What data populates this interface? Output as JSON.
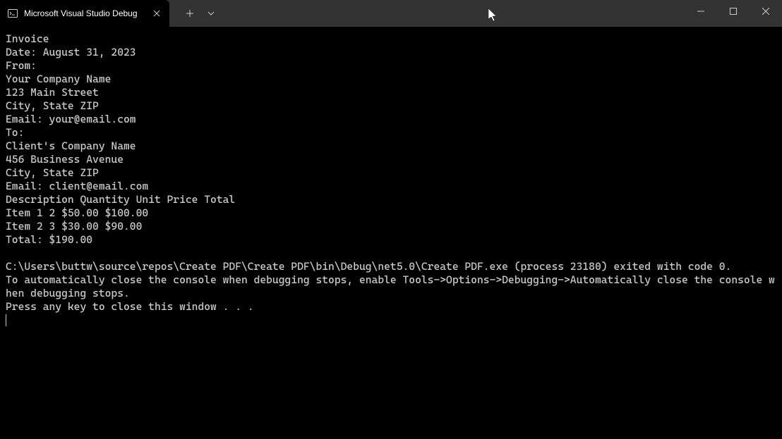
{
  "tab": {
    "title": "Microsoft Visual Studio Debug"
  },
  "output": {
    "lines": [
      "Invoice",
      "Date: August 31, 2023",
      "From:",
      "Your Company Name",
      "123 Main Street",
      "City, State ZIP",
      "Email: your@email.com",
      "To:",
      "Client's Company Name",
      "456 Business Avenue",
      "City, State ZIP",
      "Email: client@email.com",
      "Description Quantity Unit Price Total",
      "Item 1 2 $50.00 $100.00",
      "Item 2 3 $30.00 $90.00",
      "Total: $190.00",
      "",
      "C:\\Users\\buttw\\source\\repos\\Create PDF\\Create PDF\\bin\\Debug\\net5.0\\Create PDF.exe (process 23180) exited with code 0.",
      "To automatically close the console when debugging stops, enable Tools->Options->Debugging->Automatically close the console when debugging stops.",
      "Press any key to close this window . . ."
    ]
  }
}
